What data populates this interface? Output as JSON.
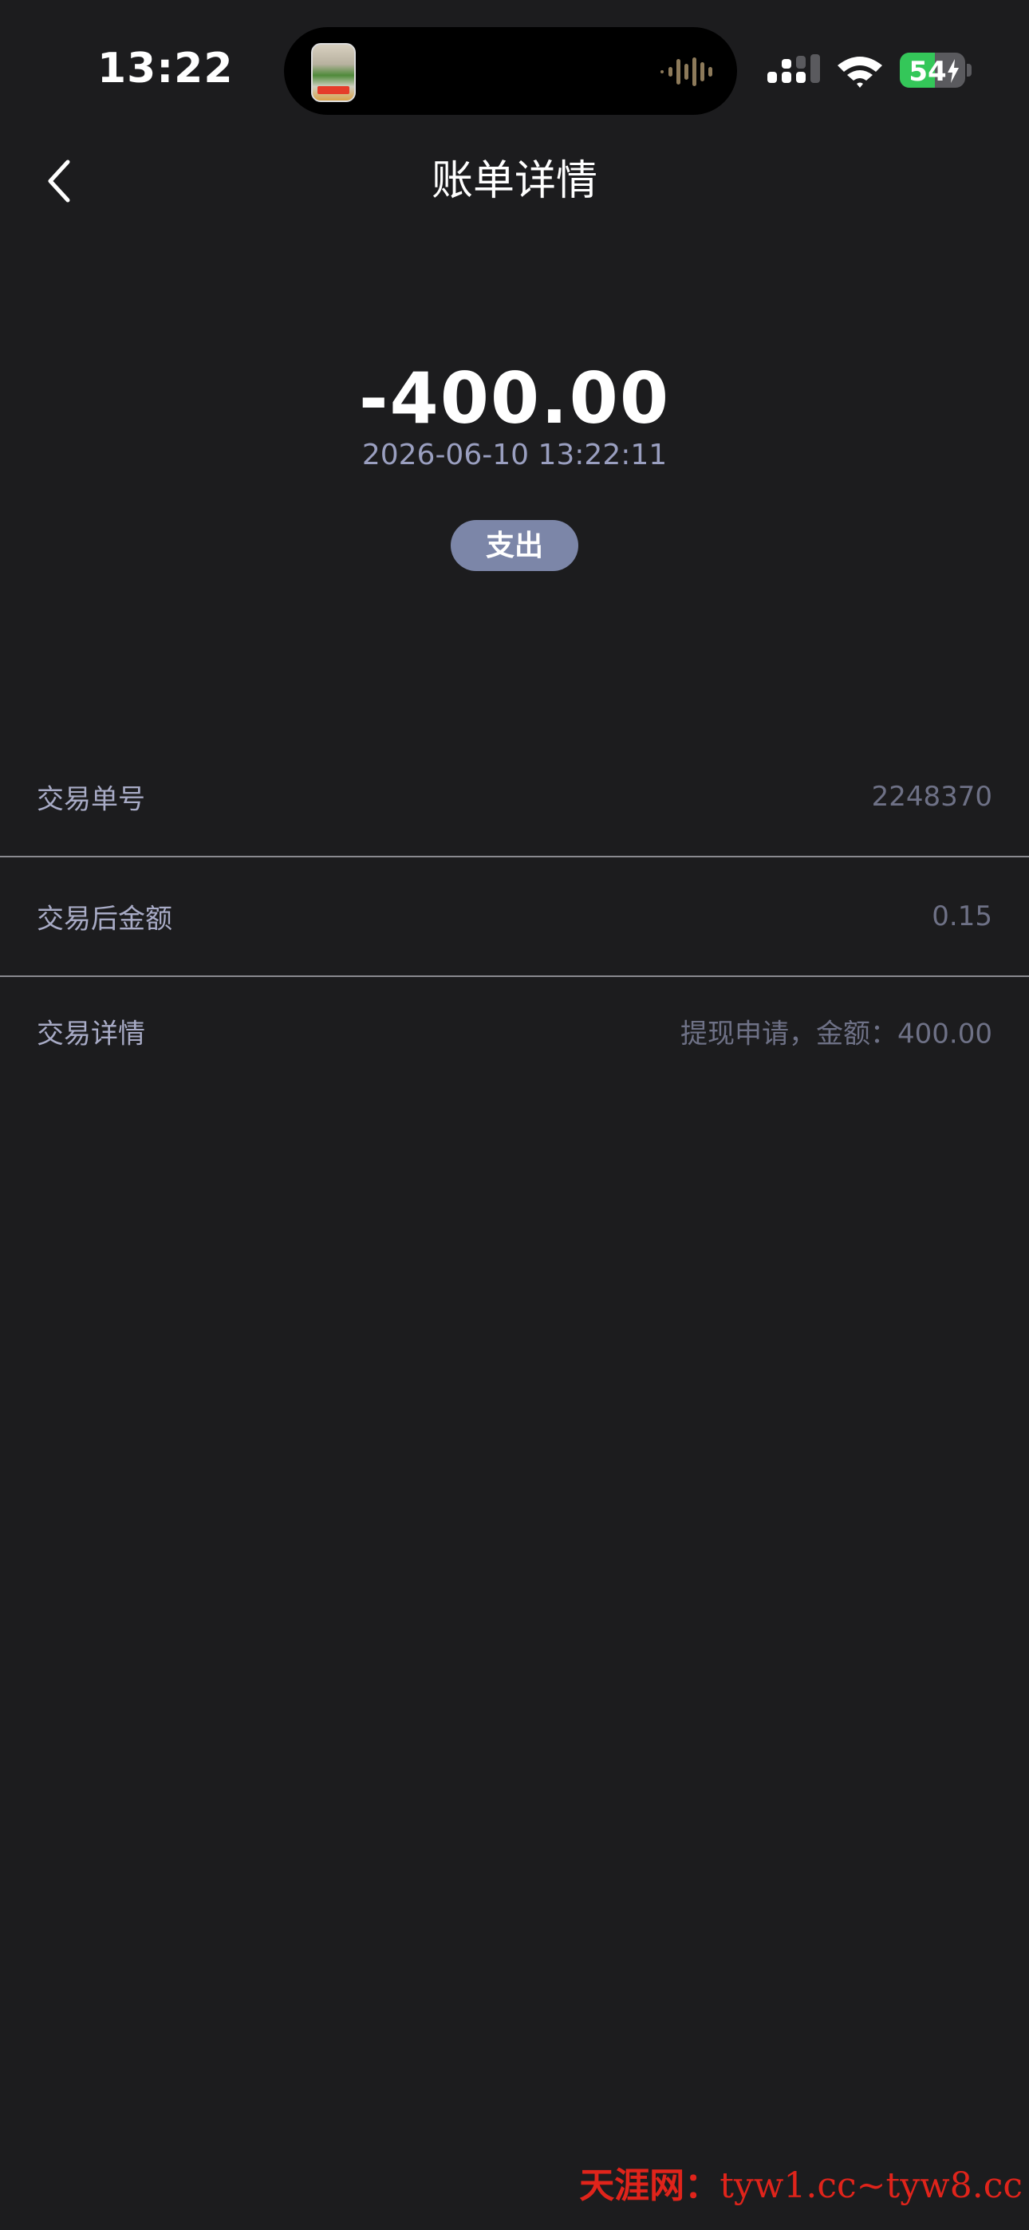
{
  "status_bar": {
    "time": "13:22",
    "battery": "54",
    "battery_level": 0.54,
    "icons": [
      "app-thumbnail-icon",
      "audio-wave-icon",
      "cellular-signal-icon",
      "wifi-icon",
      "battery-icon",
      "charging-bolt-icon"
    ]
  },
  "nav": {
    "back_icon": "chevron-left-icon",
    "title": "账单详情"
  },
  "summary": {
    "amount": "-400.00",
    "datetime": "2026-06-10 13:22:11",
    "type_badge": "支出"
  },
  "details": [
    {
      "label": "交易单号",
      "value": "2248370"
    },
    {
      "label": "交易后金额",
      "value": "0.15"
    },
    {
      "label": "交易详情",
      "value": "提现申请，金额：400.00"
    }
  ],
  "watermark": {
    "brand": "天涯网：",
    "domains": "tyw1.cc~tyw8.cc"
  },
  "colors": {
    "background": "#1c1c1e",
    "badge": "#7c86a8",
    "label": "#a8abc6",
    "value": "#6e7186",
    "battery_green": "#34c759",
    "watermark_red": "#e0241b"
  }
}
